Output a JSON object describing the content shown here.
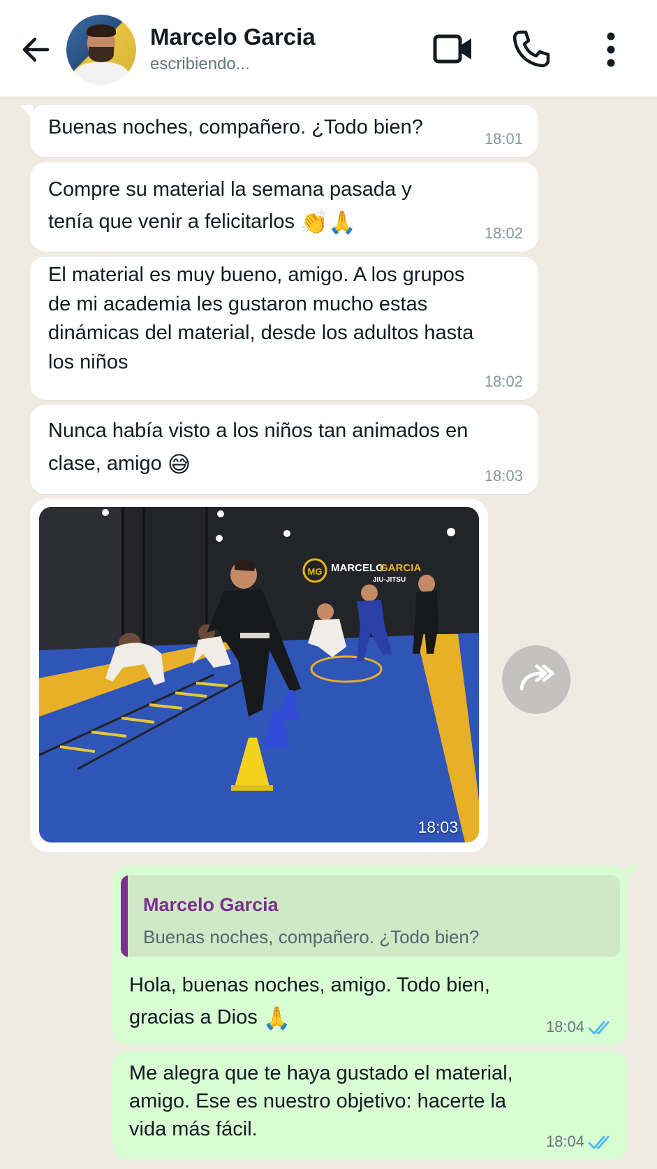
{
  "header": {
    "contact_name": "Marcelo Garcia",
    "status": "escribiendo..."
  },
  "messages": [
    {
      "lines": [
        "Buenas noches, compañero. ¿Todo bien?"
      ],
      "time": "18:01"
    },
    {
      "lines": [
        "Compre su material la semana pasada y",
        "tenía que venir a felicitarlos"
      ],
      "emoji": "👏🙏",
      "time": "18:02"
    },
    {
      "lines": [
        "El material es muy bueno, amigo. A los grupos",
        "de mi academia les gustaron mucho estas",
        "dinámicas del material, desde los adultos hasta",
        "los niños"
      ],
      "time": "18:02"
    },
    {
      "lines": [
        "Nunca había visto a los niños tan animados en",
        "clase, amigo"
      ],
      "emoji": "😅",
      "time": "18:03"
    }
  ],
  "image_message": {
    "time": "18:03",
    "banner_brand": "MARCELO",
    "banner_brand_accent": "GARCIA",
    "banner_sub": "JIU-JITSU",
    "logo_initials": "MG"
  },
  "outgoing": [
    {
      "quote_name": "Marcelo Garcia",
      "quote_text": "Buenas noches, compañero. ¿Todo bien?",
      "lines": [
        "Hola, buenas noches, amigo. Todo bien,",
        "gracias a Dios"
      ],
      "emoji": "🙏",
      "time": "18:04"
    },
    {
      "lines": [
        "Me alegra que te haya gustado el material,",
        "amigo. Ese es nuestro objetivo: hacerte la",
        "vida más fácil."
      ],
      "time": "18:04"
    }
  ],
  "colors": {
    "chat_bg": "#efeae2",
    "incoming": "#ffffff",
    "outgoing": "#d9fdd3",
    "quote_accent": "#7b2f8e",
    "read_ticks": "#53bdeb"
  }
}
